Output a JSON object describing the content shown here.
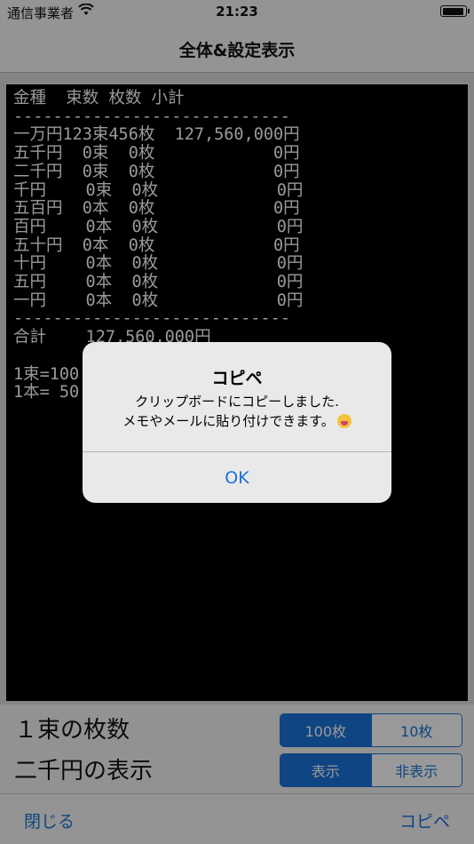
{
  "status_bar": {
    "carrier": "通信事業者",
    "wifi_icon": "wifi-icon",
    "time": "21:23",
    "battery_icon": "battery-icon"
  },
  "navbar": {
    "title": "全体&設定表示"
  },
  "summary_text": "金種  束数 枚数 小計\n----------------------------\n一万円123束456枚  127,560,000円\n五千円  0束  0枚            0円\n二千円  0束  0枚            0円\n千円    0束  0枚            0円\n五百円  0本  0枚            0円\n百円    0本  0枚            0円\n五十円  0本  0枚            0円\n十円    0本  0枚            0円\n五円    0本  0枚            0円\n一円    0本  0枚            0円\n----------------------------\n合計    127,560,000円\n\n1束=100\n1本= 50",
  "settings": {
    "bundle": {
      "label": "１束の枚数",
      "options": [
        "100枚",
        "10枚"
      ],
      "selected": "100枚"
    },
    "two_thousand": {
      "label": "二千円の表示",
      "options": [
        "表示",
        "非表示"
      ],
      "selected": "表示"
    }
  },
  "toolbar": {
    "close_label": "閉じる",
    "copy_label": "コピペ"
  },
  "alert": {
    "title": "コピペ",
    "message_line1": "クリップボードにコピーしました.",
    "message_line2": "メモやメールに貼り付けできます。",
    "emoji_icon": "tongue-face-icon",
    "ok_label": "OK"
  },
  "colors": {
    "accent": "#1a73d9",
    "terminal_bg": "#000000",
    "terminal_text": "#ffffff"
  }
}
